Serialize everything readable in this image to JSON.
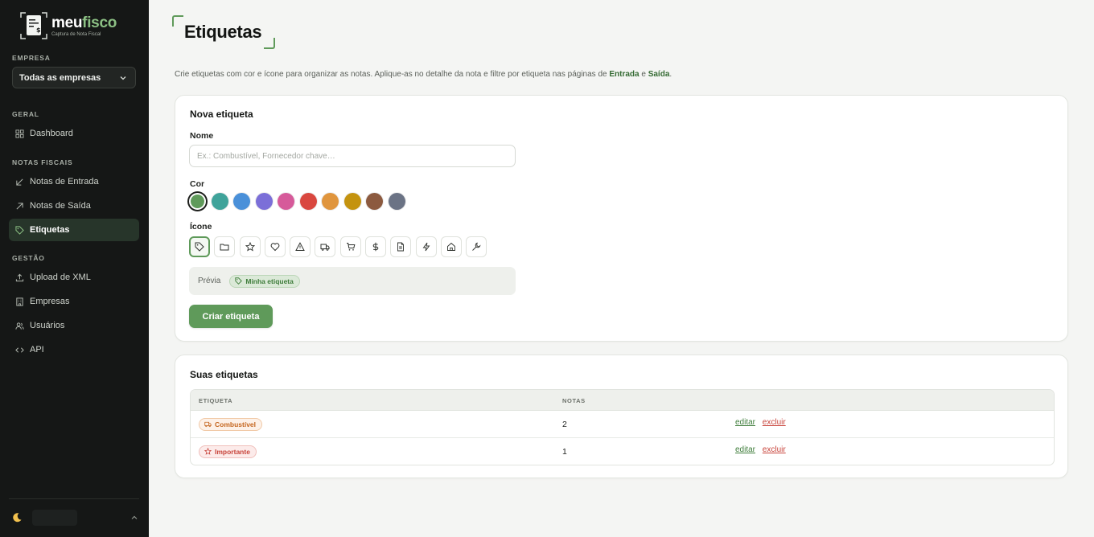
{
  "brand": {
    "name_part1": "meu",
    "name_part2": "fisco",
    "tagline": "Captura de Nota Fiscal"
  },
  "sidebar": {
    "company_label": "EMPRESA",
    "company_value": "Todas as empresas",
    "sections": [
      {
        "label": "GERAL"
      },
      {
        "label": "NOTAS FISCAIS"
      },
      {
        "label": "GESTÃO"
      }
    ],
    "items": [
      {
        "label": "Dashboard",
        "icon": "grid-icon"
      },
      {
        "label": "Notas de Entrada",
        "icon": "arrow-down-left-icon"
      },
      {
        "label": "Notas de Saída",
        "icon": "arrow-up-right-icon"
      },
      {
        "label": "Etiquetas",
        "icon": "tag-icon",
        "active": true
      },
      {
        "label": "Upload de XML",
        "icon": "upload-icon"
      },
      {
        "label": "Empresas",
        "icon": "building-icon"
      },
      {
        "label": "Usuários",
        "icon": "users-icon"
      },
      {
        "label": "API",
        "icon": "code-icon"
      }
    ]
  },
  "page": {
    "title": "Etiquetas",
    "subtitle_pre": "Crie etiquetas com cor e ícone para organizar as notas. Aplique-as no detalhe da nota e filtre por etiqueta nas páginas de ",
    "subtitle_link1": "Entrada",
    "subtitle_mid": " e ",
    "subtitle_link2": "Saída",
    "subtitle_end": "."
  },
  "new_tag": {
    "title": "Nova etiqueta",
    "name_label": "Nome",
    "name_placeholder": "Ex.: Combustível, Fornecedor chave…",
    "color_label": "Cor",
    "colors": [
      "#5f9a5a",
      "#3fa39a",
      "#4a90d9",
      "#7b6fd8",
      "#d65a9a",
      "#d9473f",
      "#e0953d",
      "#c4930f",
      "#8c5a3f",
      "#6b7385"
    ],
    "selected_color": 0,
    "icon_label": "Ícone",
    "icons": [
      "tag-icon",
      "folder-icon",
      "star-icon",
      "heart-icon",
      "alert-triangle-icon",
      "truck-icon",
      "cart-icon",
      "dollar-icon",
      "file-icon",
      "bolt-icon",
      "home-icon",
      "wrench-icon"
    ],
    "selected_icon": 0,
    "preview_label": "Prévia",
    "preview_tag": "Minha etiqueta",
    "create_button": "Criar etiqueta"
  },
  "your_tags": {
    "title": "Suas etiquetas",
    "columns": [
      "ETIQUETA",
      "NOTAS"
    ],
    "rows": [
      {
        "name": "Combustível",
        "icon": "truck-icon",
        "color": "#c5661f",
        "count": "2",
        "edit": "editar",
        "delete": "excluir"
      },
      {
        "name": "Importante",
        "icon": "star-icon",
        "color": "#c8443b",
        "count": "1",
        "edit": "editar",
        "delete": "excluir"
      }
    ]
  }
}
